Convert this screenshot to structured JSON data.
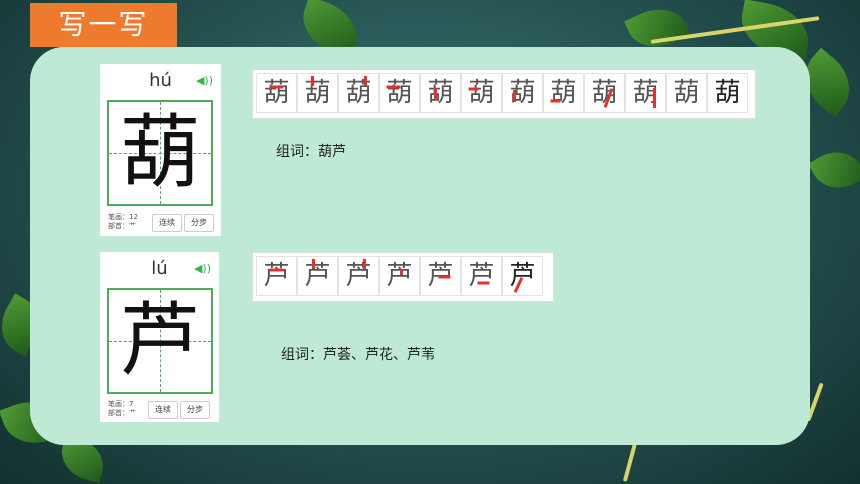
{
  "header": {
    "title": "写一写"
  },
  "cards": [
    {
      "pinyin": "hú",
      "char": "葫",
      "strokes_label": "笔画：12",
      "radical_label": "部首：艹",
      "btn_continuous": "连续",
      "btn_step": "分步",
      "stroke_steps": [
        "葫",
        "葫",
        "葫",
        "葫",
        "葫",
        "葫",
        "葫",
        "葫",
        "葫",
        "葫",
        "葫",
        "葫"
      ],
      "words": "组词：葫芦"
    },
    {
      "pinyin": "lú",
      "char": "芦",
      "strokes_label": "笔画：7",
      "radical_label": "部首：艹",
      "btn_continuous": "连续",
      "btn_step": "分步",
      "stroke_steps": [
        "芦",
        "芦",
        "芦",
        "芦",
        "芦",
        "芦",
        "芦"
      ],
      "words": "组词：芦荟、芦花、芦苇"
    }
  ],
  "icons": {
    "speaker": "speaker-icon"
  },
  "colors": {
    "accent": "#ee7b2d",
    "panel": "#bde9d5",
    "grid": "#4cae5a",
    "stroke_highlight": "#e53030"
  }
}
